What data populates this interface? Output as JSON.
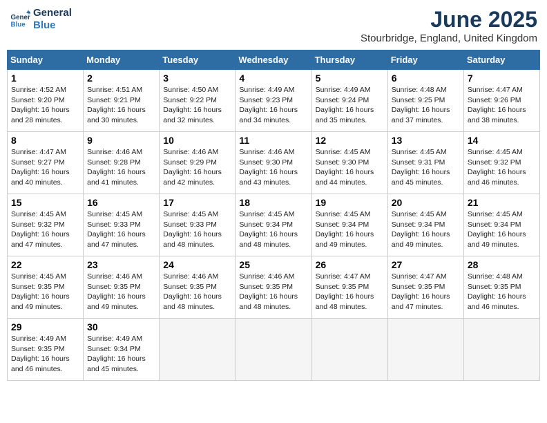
{
  "header": {
    "logo_line1": "General",
    "logo_line2": "Blue",
    "month_title": "June 2025",
    "location": "Stourbridge, England, United Kingdom"
  },
  "weekdays": [
    "Sunday",
    "Monday",
    "Tuesday",
    "Wednesday",
    "Thursday",
    "Friday",
    "Saturday"
  ],
  "weeks": [
    [
      {
        "day": "1",
        "sunrise": "4:52 AM",
        "sunset": "9:20 PM",
        "daylight": "16 hours and 28 minutes."
      },
      {
        "day": "2",
        "sunrise": "4:51 AM",
        "sunset": "9:21 PM",
        "daylight": "16 hours and 30 minutes."
      },
      {
        "day": "3",
        "sunrise": "4:50 AM",
        "sunset": "9:22 PM",
        "daylight": "16 hours and 32 minutes."
      },
      {
        "day": "4",
        "sunrise": "4:49 AM",
        "sunset": "9:23 PM",
        "daylight": "16 hours and 34 minutes."
      },
      {
        "day": "5",
        "sunrise": "4:49 AM",
        "sunset": "9:24 PM",
        "daylight": "16 hours and 35 minutes."
      },
      {
        "day": "6",
        "sunrise": "4:48 AM",
        "sunset": "9:25 PM",
        "daylight": "16 hours and 37 minutes."
      },
      {
        "day": "7",
        "sunrise": "4:47 AM",
        "sunset": "9:26 PM",
        "daylight": "16 hours and 38 minutes."
      }
    ],
    [
      {
        "day": "8",
        "sunrise": "4:47 AM",
        "sunset": "9:27 PM",
        "daylight": "16 hours and 40 minutes."
      },
      {
        "day": "9",
        "sunrise": "4:46 AM",
        "sunset": "9:28 PM",
        "daylight": "16 hours and 41 minutes."
      },
      {
        "day": "10",
        "sunrise": "4:46 AM",
        "sunset": "9:29 PM",
        "daylight": "16 hours and 42 minutes."
      },
      {
        "day": "11",
        "sunrise": "4:46 AM",
        "sunset": "9:30 PM",
        "daylight": "16 hours and 43 minutes."
      },
      {
        "day": "12",
        "sunrise": "4:45 AM",
        "sunset": "9:30 PM",
        "daylight": "16 hours and 44 minutes."
      },
      {
        "day": "13",
        "sunrise": "4:45 AM",
        "sunset": "9:31 PM",
        "daylight": "16 hours and 45 minutes."
      },
      {
        "day": "14",
        "sunrise": "4:45 AM",
        "sunset": "9:32 PM",
        "daylight": "16 hours and 46 minutes."
      }
    ],
    [
      {
        "day": "15",
        "sunrise": "4:45 AM",
        "sunset": "9:32 PM",
        "daylight": "16 hours and 47 minutes."
      },
      {
        "day": "16",
        "sunrise": "4:45 AM",
        "sunset": "9:33 PM",
        "daylight": "16 hours and 47 minutes."
      },
      {
        "day": "17",
        "sunrise": "4:45 AM",
        "sunset": "9:33 PM",
        "daylight": "16 hours and 48 minutes."
      },
      {
        "day": "18",
        "sunrise": "4:45 AM",
        "sunset": "9:34 PM",
        "daylight": "16 hours and 48 minutes."
      },
      {
        "day": "19",
        "sunrise": "4:45 AM",
        "sunset": "9:34 PM",
        "daylight": "16 hours and 49 minutes."
      },
      {
        "day": "20",
        "sunrise": "4:45 AM",
        "sunset": "9:34 PM",
        "daylight": "16 hours and 49 minutes."
      },
      {
        "day": "21",
        "sunrise": "4:45 AM",
        "sunset": "9:34 PM",
        "daylight": "16 hours and 49 minutes."
      }
    ],
    [
      {
        "day": "22",
        "sunrise": "4:45 AM",
        "sunset": "9:35 PM",
        "daylight": "16 hours and 49 minutes."
      },
      {
        "day": "23",
        "sunrise": "4:46 AM",
        "sunset": "9:35 PM",
        "daylight": "16 hours and 49 minutes."
      },
      {
        "day": "24",
        "sunrise": "4:46 AM",
        "sunset": "9:35 PM",
        "daylight": "16 hours and 48 minutes."
      },
      {
        "day": "25",
        "sunrise": "4:46 AM",
        "sunset": "9:35 PM",
        "daylight": "16 hours and 48 minutes."
      },
      {
        "day": "26",
        "sunrise": "4:47 AM",
        "sunset": "9:35 PM",
        "daylight": "16 hours and 48 minutes."
      },
      {
        "day": "27",
        "sunrise": "4:47 AM",
        "sunset": "9:35 PM",
        "daylight": "16 hours and 47 minutes."
      },
      {
        "day": "28",
        "sunrise": "4:48 AM",
        "sunset": "9:35 PM",
        "daylight": "16 hours and 46 minutes."
      }
    ],
    [
      {
        "day": "29",
        "sunrise": "4:49 AM",
        "sunset": "9:35 PM",
        "daylight": "16 hours and 46 minutes."
      },
      {
        "day": "30",
        "sunrise": "4:49 AM",
        "sunset": "9:34 PM",
        "daylight": "16 hours and 45 minutes."
      },
      null,
      null,
      null,
      null,
      null
    ]
  ]
}
